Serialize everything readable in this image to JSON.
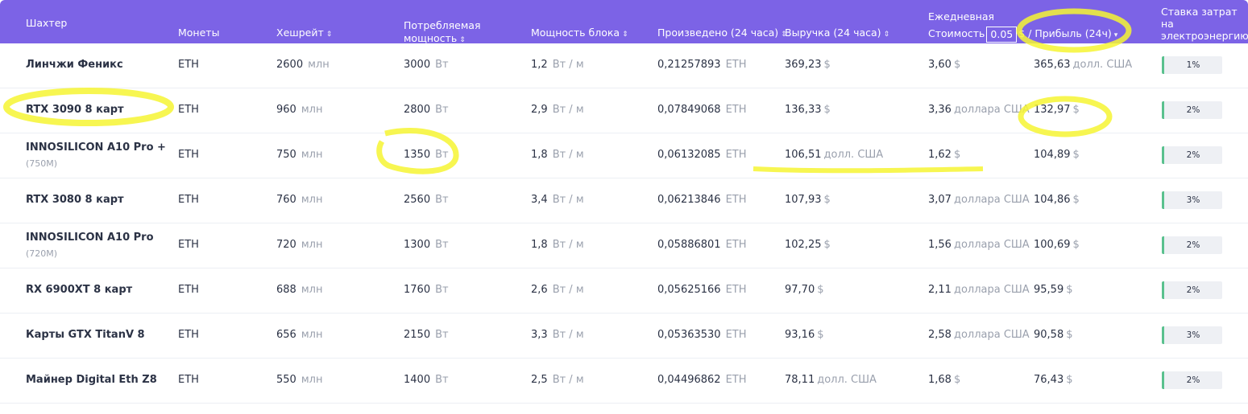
{
  "header": {
    "miner": "Шахтер",
    "coins": "Монеты",
    "hashrate": "Хешрейт",
    "power_line1": "Потребляемая",
    "power_line2": "мощность",
    "efficiency": "Мощность блока",
    "produced": "Произведено (24 часа)",
    "revenue": "Выручка (24 часа)",
    "cost_line1": "Ежедневная",
    "cost_line2": "Стоимость",
    "cost_value": "0.05",
    "cost_suffix": "$ / Прибыль (24ч)",
    "rate_line1": "Ставка затрат",
    "rate_line2": "на",
    "rate_line3": "электроэнергию",
    "sort_icon": "⇕",
    "sort_down_icon": "▾"
  },
  "rows": [
    {
      "name": "Линчжи Феникс",
      "sub": "",
      "coin": "ETH",
      "hash": "2600",
      "hash_unit": "млн",
      "power": "3000",
      "power_unit": "Вт",
      "eff": "1,2",
      "eff_unit": "Вт / м",
      "produced": "0,21257893",
      "produced_unit": "ETH",
      "revenue": "369,23",
      "revenue_cur": "$",
      "cost": "3,60",
      "cost_cur": "$",
      "profit": "365,63",
      "profit_cur": "долл. США",
      "rate": "1%"
    },
    {
      "name": "RTX 3090 8 карт",
      "sub": "",
      "coin": "ETH",
      "hash": "960",
      "hash_unit": "млн",
      "power": "2800",
      "power_unit": "Вт",
      "eff": "2,9",
      "eff_unit": "Вт / м",
      "produced": "0,07849068",
      "produced_unit": "ETH",
      "revenue": "136,33",
      "revenue_cur": "$",
      "cost": "3,36",
      "cost_cur": "доллара США",
      "profit": "132,97",
      "profit_cur": "$",
      "rate": "2%"
    },
    {
      "name": "INNOSILICON A10 Pro +",
      "sub": "(750M)",
      "coin": "ETH",
      "hash": "750",
      "hash_unit": "млн",
      "power": "1350",
      "power_unit": "Вт",
      "eff": "1,8",
      "eff_unit": "Вт / м",
      "produced": "0,06132085",
      "produced_unit": "ETH",
      "revenue": "106,51",
      "revenue_cur": "долл. США",
      "cost": "1,62",
      "cost_cur": "$",
      "profit": "104,89",
      "profit_cur": "$",
      "rate": "2%"
    },
    {
      "name": "RTX 3080 8 карт",
      "sub": "",
      "coin": "ETH",
      "hash": "760",
      "hash_unit": "млн",
      "power": "2560",
      "power_unit": "Вт",
      "eff": "3,4",
      "eff_unit": "Вт / м",
      "produced": "0,06213846",
      "produced_unit": "ETH",
      "revenue": "107,93",
      "revenue_cur": "$",
      "cost": "3,07",
      "cost_cur": "доллара США",
      "profit": "104,86",
      "profit_cur": "$",
      "rate": "3%"
    },
    {
      "name": "INNOSILICON A10 Pro",
      "sub": "(720M)",
      "coin": "ETH",
      "hash": "720",
      "hash_unit": "млн",
      "power": "1300",
      "power_unit": "Вт",
      "eff": "1,8",
      "eff_unit": "Вт / м",
      "produced": "0,05886801",
      "produced_unit": "ETH",
      "revenue": "102,25",
      "revenue_cur": "$",
      "cost": "1,56",
      "cost_cur": "доллара США",
      "profit": "100,69",
      "profit_cur": "$",
      "rate": "2%"
    },
    {
      "name": "RX 6900XT 8 карт",
      "sub": "",
      "coin": "ETH",
      "hash": "688",
      "hash_unit": "млн",
      "power": "1760",
      "power_unit": "Вт",
      "eff": "2,6",
      "eff_unit": "Вт / м",
      "produced": "0,05625166",
      "produced_unit": "ETH",
      "revenue": "97,70",
      "revenue_cur": "$",
      "cost": "2,11",
      "cost_cur": "доллара США",
      "profit": "95,59",
      "profit_cur": "$",
      "rate": "2%"
    },
    {
      "name": "Карты GTX TitanV 8",
      "sub": "",
      "coin": "ETH",
      "hash": "656",
      "hash_unit": "млн",
      "power": "2150",
      "power_unit": "Вт",
      "eff": "3,3",
      "eff_unit": "Вт / м",
      "produced": "0,05363530",
      "produced_unit": "ETH",
      "revenue": "93,16",
      "revenue_cur": "$",
      "cost": "2,58",
      "cost_cur": "доллара США",
      "profit": "90,58",
      "profit_cur": "$",
      "rate": "3%"
    },
    {
      "name": "Майнер Digital Eth Z8",
      "sub": "",
      "coin": "ETH",
      "hash": "550",
      "hash_unit": "млн",
      "power": "1400",
      "power_unit": "Вт",
      "eff": "2,5",
      "eff_unit": "Вт / м",
      "produced": "0,04496862",
      "produced_unit": "ETH",
      "revenue": "78,11",
      "revenue_cur": "долл. США",
      "cost": "1,68",
      "cost_cur": "$",
      "profit": "76,43",
      "profit_cur": "$",
      "rate": "2%"
    }
  ],
  "colors": {
    "header_bg": "#7c63e6",
    "highlight": "#f6f532",
    "rate_bar": "#5ac18e"
  }
}
